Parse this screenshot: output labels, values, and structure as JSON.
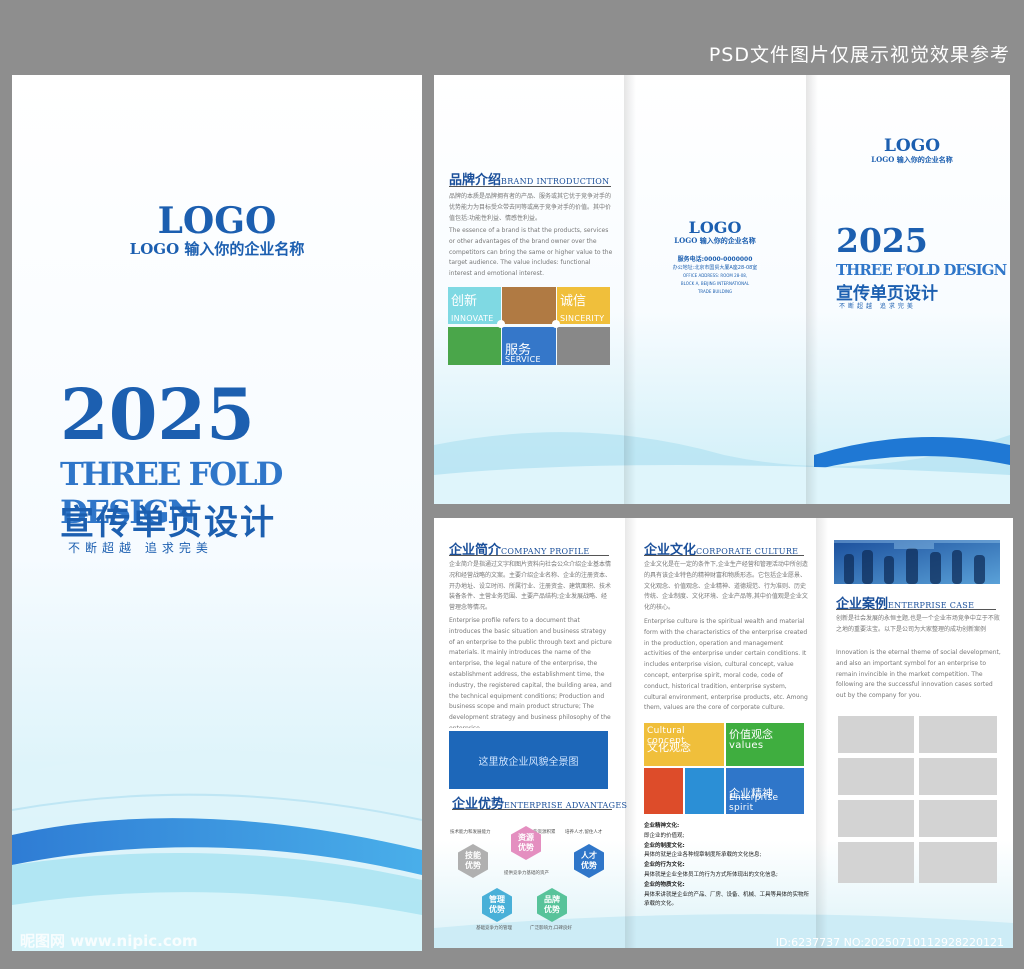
{
  "top_note": "PSD文件图片仅展示视觉效果参考",
  "cover": {
    "logo": "LOGO",
    "logo_sub": "LOGO 输入你的企业名称",
    "year": "2025",
    "fold_title": "THREE FOLD DESIGN",
    "cn_title": "宣传单页设计",
    "slogan": "不断超越   追求完美"
  },
  "outer": {
    "brand": {
      "title_cn": "品牌介绍",
      "title_en": "BRAND INTRODUCTION",
      "text_cn": "品牌的本质是品牌拥有者的产品、服务或其它优于竞争对手的优势能力为目标受众带去同等或高于竞争对手的价值。其中价值包括:功能性利益、情感性利益。",
      "text_en": "The essence of a brand is that the products, services or other advantages of the brand owner over the competitors can bring the same or higher value to the target audience. The value includes: functional interest and emotional interest.",
      "tiles": [
        {
          "cn": "创新",
          "en": "INNOVATE",
          "color": "#7fd9e3"
        },
        {
          "cn": "",
          "en": "",
          "color": "#b07a43"
        },
        {
          "cn": "诚信",
          "en": "SINCERITY",
          "color": "#f0bf3b"
        },
        {
          "cn": "",
          "en": "",
          "color": "#4aa64a"
        },
        {
          "cn": "服务",
          "en": "SERVICE",
          "color": "#3577c9"
        },
        {
          "cn": "",
          "en": "",
          "color": "#888888"
        }
      ]
    },
    "back": {
      "logo": "LOGO",
      "logo_sub": "LOGO 输入你的企业名称",
      "phone": "服务电话:0000-0000000",
      "address_cn": "办公地址:北京市国贸大厦A座28-08室",
      "address_en1": "OFFICE ADDRESS: ROOM 28-08,",
      "address_en2": "BLOCK A, BEIJING INTERNATIONAL",
      "address_en3": "TRADE BUILDING"
    },
    "front": {
      "logo": "LOGO",
      "logo_sub": "LOGO 输入你的企业名称",
      "year": "2025",
      "fold_title": "THREE FOLD DESIGN",
      "cn_title": "宣传单页设计",
      "slogan": "不断超越   追求完美"
    }
  },
  "inner": {
    "profile": {
      "title_cn": "企业简介",
      "title_en": "COMPANY PROFILE",
      "text_cn": "企业简介是指通过文字和图片资料向社会公众介绍企业基本情况和经营战略的文案。主要介绍企业名称、企业的注册资本、开办地址、设立时间、所属行业、注册资金、建筑面积、技术装备条件、主营业务范围、主要产品结构;企业发展战略、经营理念等情况。",
      "text_en": "Enterprise profile refers to a document that introduces the basic situation and business strategy of an enterprise to the public through text and picture materials. It mainly introduces the name of the enterprise, the legal nature of the enterprise, the establishment address, the establishment time, the industry, the registered capital, the building area, and the technical equipment conditions; Production and business scope and main product structure; The development strategy and business philosophy of the enterprise.",
      "banner": "这里放企业风貌全景图"
    },
    "advantages": {
      "title_cn": "企业优势",
      "title_en": "ENTERPRISE ADVANTAGES",
      "hexes": [
        {
          "label": "技能优势",
          "color": "#b0b0b0"
        },
        {
          "label": "资源优势",
          "color": "#e48fc0"
        },
        {
          "label": "人才优势",
          "color": "#2f76c9"
        },
        {
          "label": "管理优势",
          "color": "#49b0d8"
        },
        {
          "label": "品牌优势",
          "color": "#58c39a"
        }
      ],
      "notes": [
        "技术能力和发展能力",
        "强大的资源积累",
        "培养人才,留住人才",
        "提供竞争力基础的资产",
        "基础竞争力的管理",
        "广泛影响力,口碑良好"
      ]
    },
    "culture": {
      "title_cn": "企业文化",
      "title_en": "CORPORATE CULTURE",
      "text_cn": "企业文化是在一定的条件下,企业生产经营和管理活动中所创造的具有该企业特色的精神财富和物质形态。它包括企业愿景、文化观念、价值观念、企业精神、道德规范、行为准则、历史传统、企业制度、文化环境、企业产品等,其中价值观是企业文化的核心。",
      "text_en": "Enterprise culture is the spiritual wealth and material form with the characteristics of the enterprise created in the production, operation and management activities of the enterprise under certain conditions. It includes enterprise vision, cultural concept, value concept, enterprise spirit, moral code, code of conduct, historical tradition, enterprise system, cultural environment, enterprise products, etc. Among them, values are the core of corporate culture.",
      "tiles": [
        {
          "cn": "文化观念",
          "en": "Cultural concept",
          "color": "#f0bf3b"
        },
        {
          "cn": "价值观念",
          "en": "values",
          "color": "#3fae3f"
        },
        {
          "cn": "",
          "en": "",
          "color": "#dd4c2a"
        },
        {
          "cn": "",
          "en": "",
          "color": "#2b8fd6"
        },
        {
          "cn": "企业精神",
          "en": "Enterprise spirit",
          "color": "#2f76c9"
        }
      ],
      "list": [
        {
          "head": "企业精神文化:",
          "body": "即企业的价值观;"
        },
        {
          "head": "企业的制度文化:",
          "body": "具体的就是企业各种规章制度所承载的文化信息;"
        },
        {
          "head": "企业的行为文化:",
          "body": "具体就是企业全体员工的行为方式所体现出的文化信息;"
        },
        {
          "head": "企业的物质文化:",
          "body": "具体来讲就是企业的产品、厂房、设备、机械、工具等具体的实物所承载的文化。"
        }
      ]
    },
    "cases": {
      "title_cn": "企业案例",
      "title_en": "ENTERPRISE CASE",
      "text_cn": "创新是社会发展的永恒主题,也是一个企业市场竞争中立于不败之地的重要法宝。以下是公司为大家整理的成功创新案例",
      "text_en": "Innovation is the eternal theme of social development, and also an important symbol for an enterprise to remain invincible in the market competition. The following are the successful innovation cases sorted out by the company for you."
    }
  },
  "footer": {
    "watermark": "昵图网 www.nipic.com",
    "id": "ID:6237737 NO:20250710112928220121"
  }
}
